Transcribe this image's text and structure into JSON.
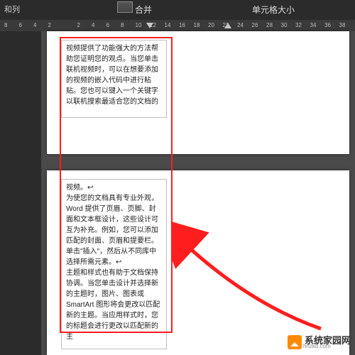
{
  "ribbon": {
    "rows_cols_tab": "和列",
    "merge_label": "合并",
    "cellsize_label": "单元格大小"
  },
  "ruler": {
    "ticks": [
      "8",
      "6",
      "4",
      "2",
      "",
      "2",
      "4",
      "6",
      "8",
      "10",
      "12",
      "14",
      "16",
      "18",
      "20",
      "22",
      "24",
      "26",
      "28",
      "30",
      "32",
      "34",
      "36",
      "38"
    ]
  },
  "document": {
    "page1": {
      "cell_text": "视频提供了功能强大的方法帮助您证明您的观点。当您单击联机视频时，可以在想要添加的视频的嵌入代码中进行粘贴。您也可以键入一个关键字以联机搜索最适合您的文档的"
    },
    "page2": {
      "cell_text": "视频。↩\n为使您的文档具有专业外观，Word 提供了页眉、页脚、封面和文本框设计，这些设计可互为补充。例如，您可以添加匹配的封面、页眉和提要栏。单击\"插入\"，然后从不同库中选择所需元素。↩\n主题和样式也有助于文档保持协调。当您单击设计并选择新的主题时，图片、图表或 SmartArt 图形将会更改以匹配新的主题。当应用样式时，您的标题会进行更改以匹配新的主"
    }
  },
  "watermark": {
    "cn": "系统家园网",
    "en": "hnzkb.com"
  },
  "colors": {
    "highlight": "#ff1e1e",
    "ribbon_bg": "#2b2b2b",
    "canvas_bg": "#4a4a4a",
    "logo": "#ff8a00"
  }
}
